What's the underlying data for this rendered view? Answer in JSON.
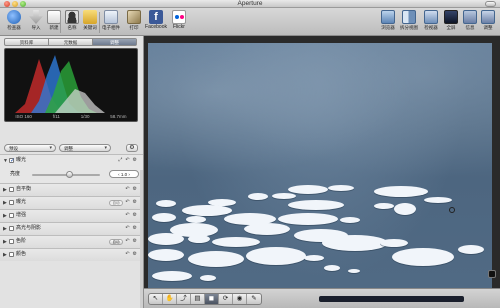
{
  "window": {
    "title": "Aperture"
  },
  "toolbar": {
    "items": [
      {
        "label": "检查器",
        "icon": "inspector-icon"
      },
      {
        "label": "导入",
        "icon": "import-icon"
      },
      {
        "label": "新建",
        "icon": "new-icon"
      },
      {
        "label": "名称",
        "icon": "name-icon"
      },
      {
        "label": "关键词",
        "icon": "keyword-icon"
      },
      {
        "label": "电子相件",
        "icon": "email-icon"
      },
      {
        "label": "打印",
        "icon": "print-icon"
      },
      {
        "label": "Facebook",
        "icon": "facebook-icon"
      },
      {
        "label": "Flickr",
        "icon": "flickr-icon"
      }
    ],
    "right_items": [
      {
        "label": "浏览器",
        "icon": "browser-icon"
      },
      {
        "label": "拆分视图",
        "icon": "split-view-icon"
      },
      {
        "label": "检视器",
        "icon": "viewer-icon"
      },
      {
        "label": "全屏",
        "icon": "fullscreen-icon"
      },
      {
        "label": "信息",
        "icon": "info-icon"
      },
      {
        "label": "调整",
        "icon": "adjust-icon"
      }
    ]
  },
  "inspector": {
    "tabs": [
      {
        "label": "资料库",
        "active": false
      },
      {
        "label": "元数据",
        "active": false
      },
      {
        "label": "调整",
        "active": true
      }
    ],
    "exif": {
      "iso": "ISO 160",
      "aperture": "f/11",
      "shutter": "1/30",
      "focal": "58.7mm"
    },
    "preset_label": "预设",
    "adjust_label": "调整",
    "adjustments": [
      {
        "name": "曝光",
        "checked": true,
        "expanded": true,
        "slider_label": "亮度",
        "slider_value": "1.0",
        "slider_fraction": 0.55
      },
      {
        "name": "自平衡",
        "checked": false
      },
      {
        "name": "曝光",
        "checked": false,
        "pill": "自动"
      },
      {
        "name": "增强",
        "checked": false
      },
      {
        "name": "高光与阴影",
        "checked": false
      },
      {
        "name": "色阶",
        "checked": false,
        "pill": "自动"
      },
      {
        "name": "颜色",
        "checked": false
      }
    ]
  },
  "viewer": {
    "tools": [
      "pointer-icon",
      "hand-icon",
      "lift-icon",
      "stamp-icon",
      "crop-icon",
      "straighten-icon",
      "loupe-icon",
      "brush-icon"
    ],
    "active_tool_index": 4
  },
  "colors": {
    "accent": "#4d6680",
    "active_tab": "#6e7b90"
  }
}
